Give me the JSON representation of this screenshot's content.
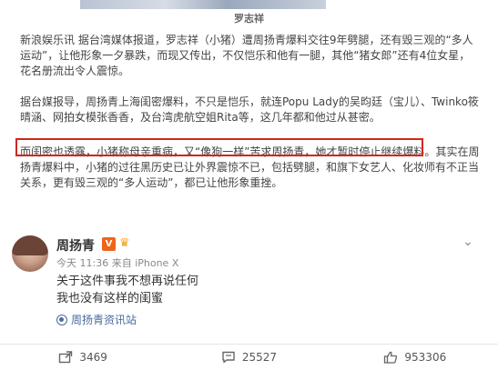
{
  "article": {
    "caption": "罗志祥",
    "paragraph1": "新浪娱乐讯 据台湾媒体报道，罗志祥（小猪）遭周扬青爆料交往9年劈腿，还有毁三观的“多人运动”，让他形象一夕暴跌，而现又传出，不仅恺乐和他有一腿，其他“猪女郎”还有4位女星，花名册流出令人震惊。",
    "paragraph2": "据台媒报导，周扬青上海闺密爆料，不只是恺乐，就连Popu Lady的吴昀廷（宝儿）、Twinko筱晴涵、网拍女模张香香，及台湾虎航空姐Rita等，这几年都和他过从甚密。",
    "paragraph3_highlighted": "而闺密也透露，小猪称母亲重病，又“像狗一样”苦求周扬青，她才暂时停止继续爆料。",
    "paragraph3_rest": "其实在周扬青爆料中，小猪的过往黑历史已让外界震惊不已，包括劈腿，和旗下女艺人、化妆师有不正当关系，更有毁三观的“多人运动”，都已让他形象重挫。"
  },
  "post": {
    "username": "周扬青",
    "vip_badge": "V",
    "meta": "今天 11:36 来自 iPhone X",
    "text_line1": "关于这件事我不想再说任何",
    "text_line2": "我也没有这样的闺蜜",
    "source": "周扬青资讯站",
    "actions": {
      "repost_count": "3469",
      "comment_count": "25527",
      "like_count": "953306"
    },
    "colors": {
      "highlight_border": "#d1261f",
      "link": "#4a6b9e",
      "vip": "#f1631a"
    }
  }
}
